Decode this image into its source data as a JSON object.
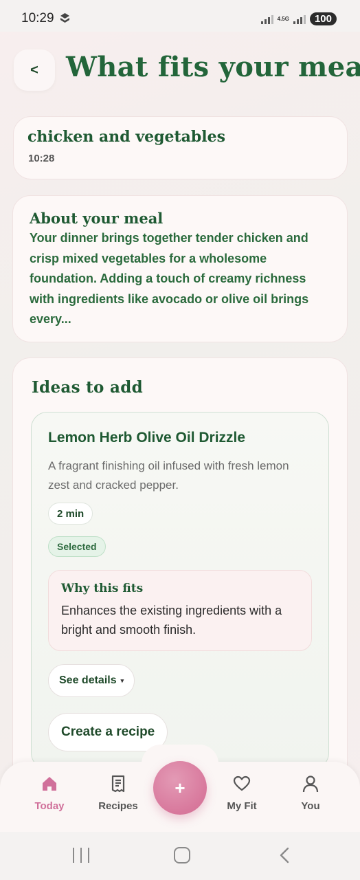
{
  "status_bar": {
    "time": "10:29",
    "network": "4.5G",
    "battery": "100"
  },
  "header": {
    "back_label": "<",
    "title": "What fits your meal"
  },
  "meal": {
    "name": "chicken and vegetables",
    "time": "10:28"
  },
  "about": {
    "title": "About your meal",
    "text": "Your dinner brings together tender chicken and crisp mixed vegetables for a wholesome foundation. Adding a touch of creamy richness with ingredients like avocado or olive oil brings every..."
  },
  "ideas": {
    "title": "Ideas to add",
    "item": {
      "name": "Lemon Herb Olive Oil Drizzle",
      "description": "A fragrant finishing oil infused with fresh lemon zest and cracked pepper.",
      "time": "2 min",
      "status": "Selected",
      "why_title": "Why this fits",
      "why_text": "Enhances the existing ingredients with a bright and smooth finish.",
      "details_label": "See details",
      "details_caret": "▾",
      "recipe_label": "Create a recipe"
    }
  },
  "bottom_nav": {
    "items": [
      {
        "label": "Today",
        "icon": "home-icon",
        "active": true
      },
      {
        "label": "Recipes",
        "icon": "recipe-icon",
        "active": false
      },
      {
        "label": "My Fit",
        "icon": "heart-icon",
        "active": false
      },
      {
        "label": "You",
        "icon": "person-icon",
        "active": false
      }
    ],
    "fab_label": "+"
  },
  "colors": {
    "accent": "#d8789c",
    "primary_text": "#1f5a33",
    "selected_bg": "#e5f3e8"
  }
}
